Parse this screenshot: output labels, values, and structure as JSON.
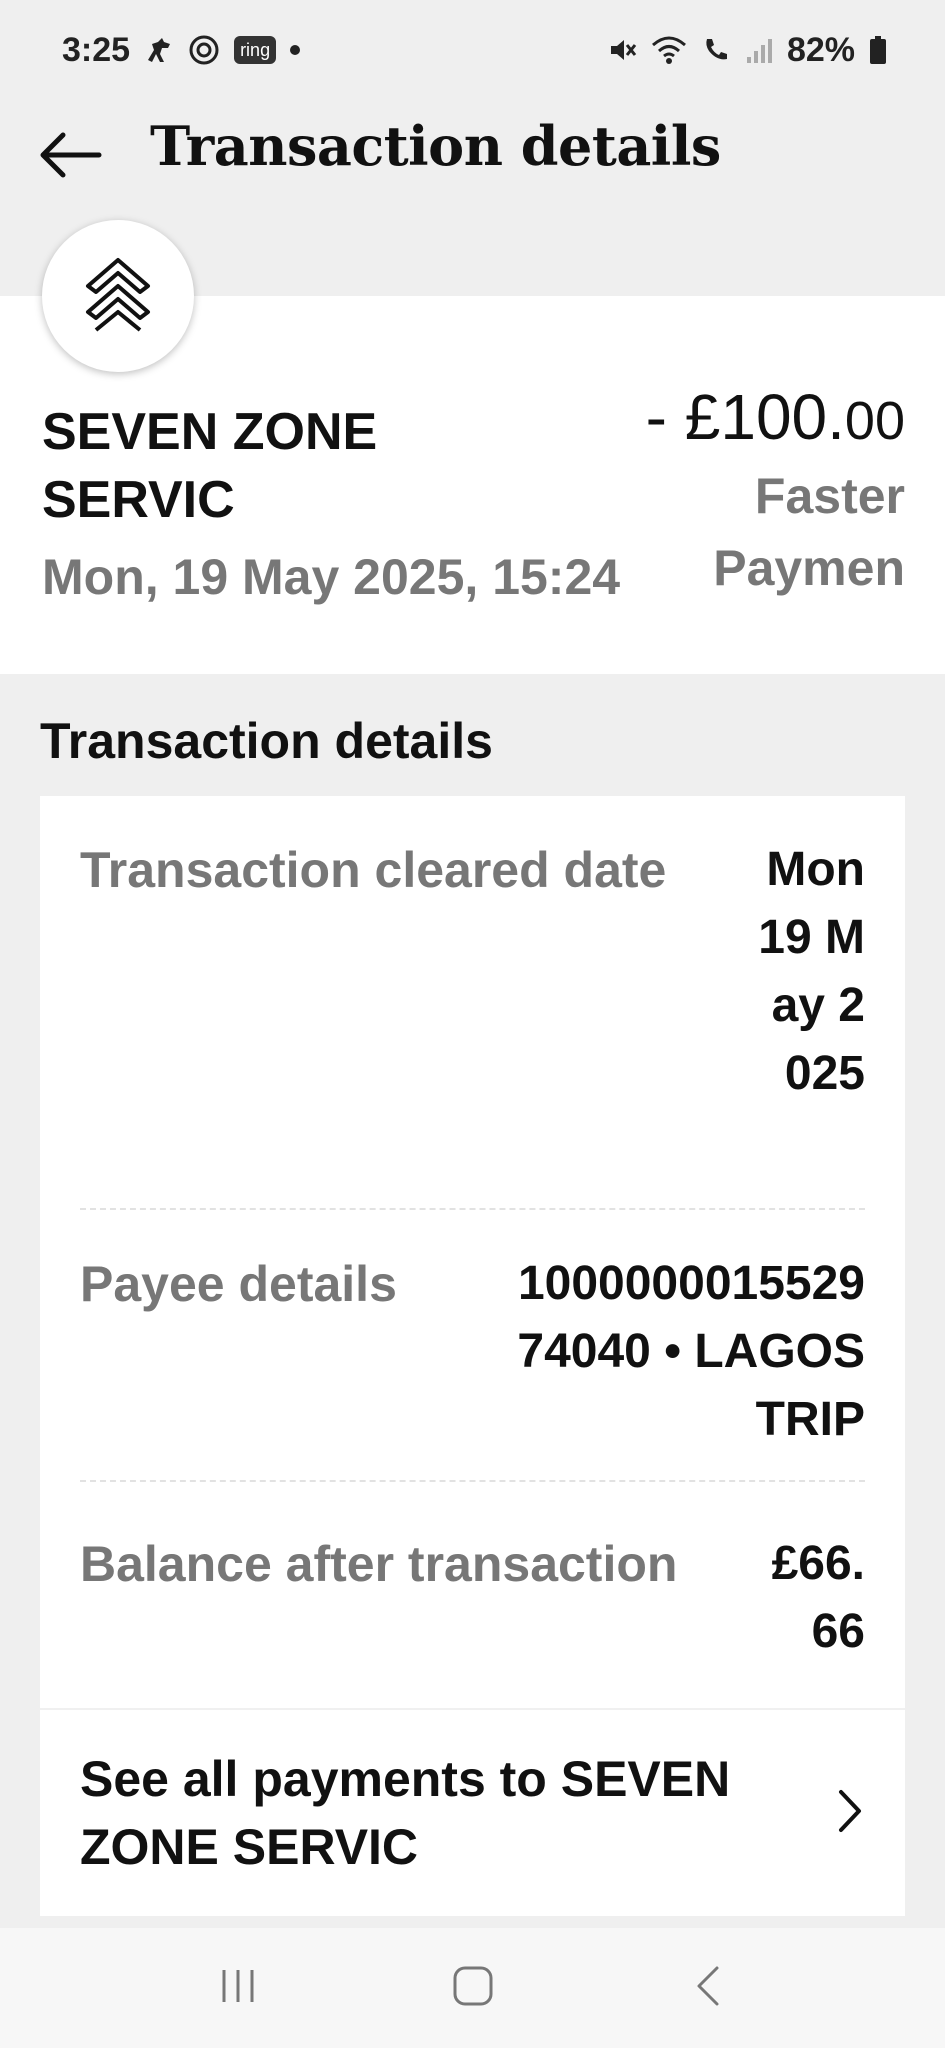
{
  "status_bar": {
    "time": "3:25",
    "ring_label": "ring",
    "battery": "82%",
    "icons": [
      "horse-icon",
      "threads-icon",
      "ring-icon",
      "mute-icon",
      "wifi-icon",
      "wifi-calling-icon",
      "signal-icon",
      "battery-icon"
    ]
  },
  "header": {
    "title": "Transaction details",
    "back_icon": "arrow-left-icon"
  },
  "summary": {
    "merchant_name": "SEVEN ZONE SERVIC",
    "datetime": "Mon, 19 May 2025, 15:24",
    "amount_major": "- £100.",
    "amount_minor": "00",
    "payment_type": "Faster Paymen",
    "logo_icon": "chevron-up-double-icon"
  },
  "details": {
    "section_title": "Transaction details",
    "rows": [
      {
        "label": "Transaction cleared date",
        "value": "Mon 19 May 2025"
      },
      {
        "label": "Payee details",
        "value": "100000001552974040 • LAGOS TRIP"
      },
      {
        "label": "Balance after transaction",
        "value": "£66.66"
      }
    ],
    "see_all_label": "See all payments to SEVEN ZONE  SERVIC"
  },
  "nav_bar": {
    "icons": [
      "recent-apps-icon",
      "home-icon",
      "back-icon"
    ]
  },
  "colors": {
    "background": "#efefef",
    "card": "#ffffff",
    "primary_text": "#111111",
    "secondary_text": "#777777"
  }
}
